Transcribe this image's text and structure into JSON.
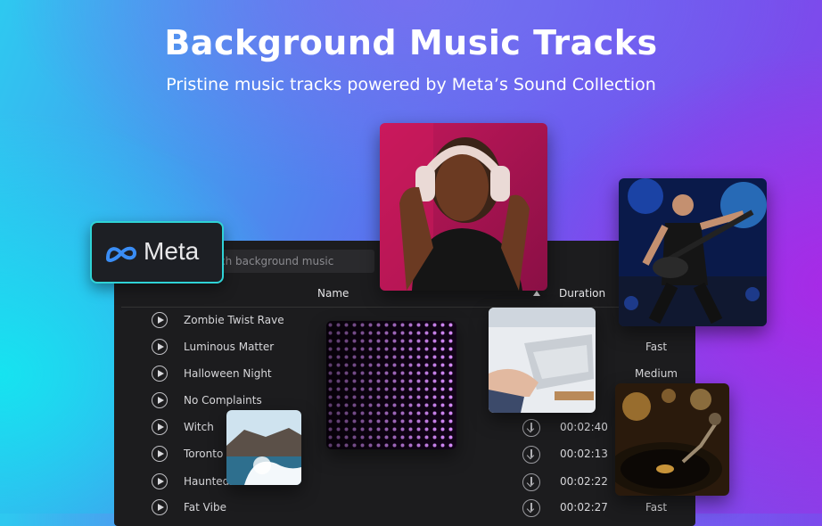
{
  "hero": {
    "title": "Background Music Tracks",
    "subtitle": "Pristine music tracks powered by Meta’s Sound Collection"
  },
  "brand": {
    "name": "Meta",
    "logo_icon": "meta-infinity-icon",
    "accent": "#2fd3d6"
  },
  "search": {
    "placeholder": "Search background music",
    "visible_text": "ch background music"
  },
  "table": {
    "columns": {
      "name": "Name",
      "duration": "Duration"
    },
    "tracks": [
      {
        "name": "Zombie Twist Rave",
        "duration": "",
        "tempo": ""
      },
      {
        "name": "Luminous Matter",
        "duration": "",
        "tempo": "Fast"
      },
      {
        "name": "Halloween Night",
        "duration": "",
        "tempo": "Medium"
      },
      {
        "name": "No Complaints",
        "duration": "",
        "tempo": ""
      },
      {
        "name": "Witch",
        "duration": "00:02:40",
        "tempo": ""
      },
      {
        "name": "Toronto",
        "duration": "00:02:13",
        "tempo": ""
      },
      {
        "name": "Haunted Funhouse",
        "duration": "00:02:22",
        "tempo": ""
      },
      {
        "name": "Fat Vibe",
        "duration": "00:02:27",
        "tempo": "Fast"
      }
    ]
  },
  "photos": [
    "woman-headphones-photo",
    "guitarist-concert-photo",
    "led-wall-photo",
    "laptop-typing-photo",
    "ocean-wave-photo",
    "turntable-photo"
  ]
}
